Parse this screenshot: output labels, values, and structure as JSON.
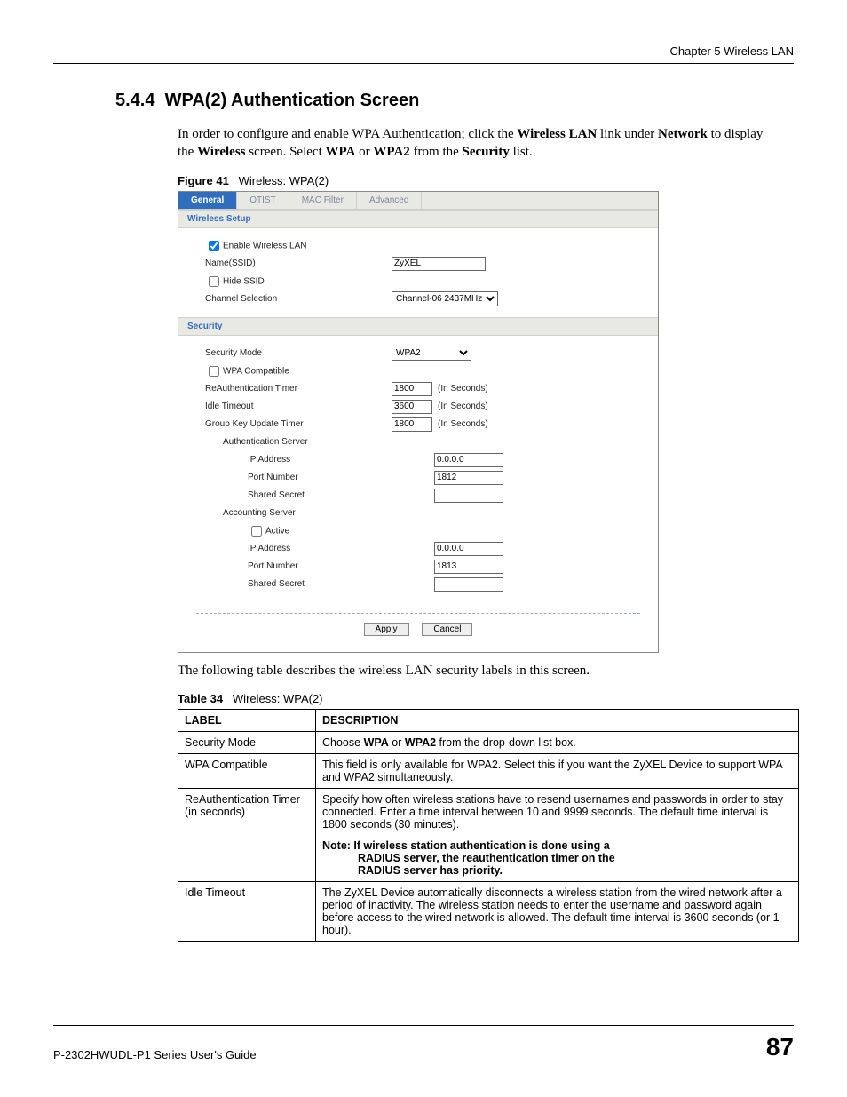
{
  "header": {
    "chapter": "Chapter 5 Wireless LAN"
  },
  "section": {
    "number": "5.4.4",
    "title": "WPA(2) Authentication Screen"
  },
  "intro": {
    "p1_a": "In order to configure and enable WPA Authentication; click the ",
    "p1_b": "Wireless LAN",
    "p1_c": " link under ",
    "p1_d": "Network",
    "p1_e": " to display the ",
    "p1_f": "Wireless",
    "p1_g": " screen. Select ",
    "p1_h": "WPA",
    "p1_i": " or ",
    "p1_j": "WPA2",
    "p1_k": " from the ",
    "p1_l": "Security",
    "p1_m": " list."
  },
  "figure": {
    "label": "Figure 41",
    "title": "Wireless: WPA(2)"
  },
  "tabs": {
    "general": "General",
    "otist": "OTIST",
    "macfilter": "MAC Filter",
    "advanced": "Advanced"
  },
  "screenshot": {
    "section1": "Wireless Setup",
    "enable_wlan": "Enable Wireless LAN",
    "name_ssid": "Name(SSID)",
    "ssid_value": "ZyXEL",
    "hide_ssid": "Hide SSID",
    "channel_sel": "Channel Selection",
    "channel_value": "Channel-06 2437MHz",
    "section2": "Security",
    "sec_mode": "Security Mode",
    "sec_mode_value": "WPA2",
    "wpa_compat": "WPA Compatible",
    "reauth_timer": "ReAuthentication Timer",
    "reauth_value": "1800",
    "idle_timeout": "Idle Timeout",
    "idle_value": "3600",
    "group_key": "Group Key Update Timer",
    "group_value": "1800",
    "in_seconds": "(In Seconds)",
    "auth_server": "Authentication Server",
    "ip_address": "IP Address",
    "auth_ip": "0.0.0.0",
    "port_number": "Port Number",
    "auth_port": "1812",
    "shared_secret": "Shared Secret",
    "acct_server": "Accounting Server",
    "active": "Active",
    "acct_ip": "0.0.0.0",
    "acct_port": "1813",
    "btn_apply": "Apply",
    "btn_cancel": "Cancel"
  },
  "after_fig": "The following table describes the wireless LAN security labels in this screen.",
  "table_caption": {
    "label": "Table 34",
    "title": "Wireless: WPA(2)"
  },
  "table": {
    "h1": "LABEL",
    "h2": "DESCRIPTION",
    "r1_l": "Security Mode",
    "r1_d_a": "Choose ",
    "r1_d_b": "WPA",
    "r1_d_c": " or ",
    "r1_d_d": "WPA2",
    "r1_d_e": " from the drop-down list box.",
    "r2_l": "WPA Compatible",
    "r2_d": "This field is only available for WPA2. Select this if you want the ZyXEL Device to support WPA and WPA2 simultaneously.",
    "r3_l": "ReAuthentication Timer (in seconds)",
    "r3_d": "Specify how often wireless stations have to resend usernames and passwords in order to stay connected. Enter a time interval between 10 and 9999 seconds. The default time interval is 1800 seconds (30 minutes).",
    "r3_note_a": "Note: If wireless station authentication is done using a",
    "r3_note_b": "RADIUS server, the reauthentication timer on the",
    "r3_note_c": "RADIUS server has priority.",
    "r4_l": "Idle Timeout",
    "r4_d": "The ZyXEL Device automatically disconnects a wireless station from the wired network after a period of inactivity. The wireless station needs to enter the username and password again before access to the wired network is allowed. The default time interval is 3600 seconds (or 1 hour)."
  },
  "footer": {
    "guide": "P-2302HWUDL-P1 Series User's Guide",
    "page": "87"
  }
}
